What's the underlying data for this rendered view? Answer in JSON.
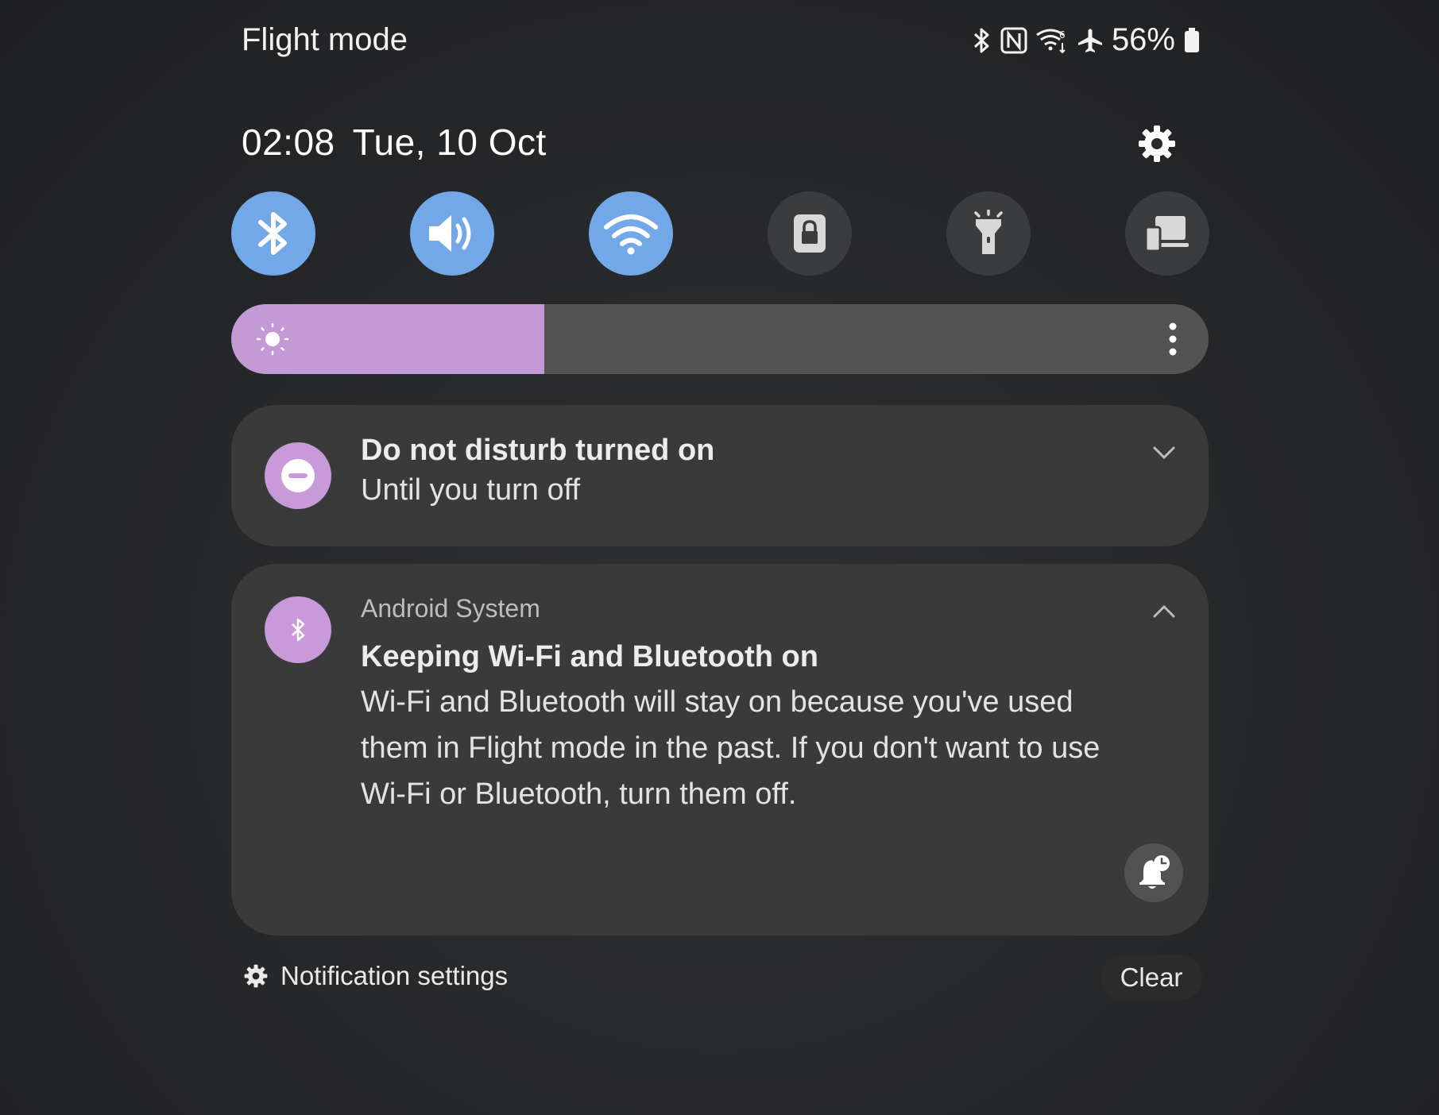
{
  "status_bar": {
    "mode_label": "Flight mode",
    "icons": [
      "bluetooth-icon",
      "nfc-icon",
      "wifi-6-icon",
      "airplane-icon",
      "battery-icon"
    ],
    "battery_text": "56%"
  },
  "header": {
    "time": "02:08",
    "date": "Tue, 10 Oct",
    "settings_icon": "gear-icon"
  },
  "quick_tiles": [
    {
      "name": "bluetooth",
      "icon": "bluetooth-icon",
      "active": true
    },
    {
      "name": "sound",
      "icon": "volume-icon",
      "active": true
    },
    {
      "name": "wifi",
      "icon": "wifi-icon",
      "active": true
    },
    {
      "name": "secure-folder",
      "icon": "lock-icon",
      "active": false
    },
    {
      "name": "torch",
      "icon": "flashlight-icon",
      "active": false
    },
    {
      "name": "device-control",
      "icon": "devices-icon",
      "active": false
    }
  ],
  "brightness": {
    "level": 0.32,
    "icon": "sun-icon",
    "more_icon": "more-vertical-icon",
    "fill_color": "#c39ad6"
  },
  "notifications": [
    {
      "icon": "dnd-icon",
      "title": "Do not disturb turned on",
      "text": "Until you turn off",
      "expanded": false
    },
    {
      "icon": "bluetooth-icon",
      "app": "Android System",
      "title": "Keeping Wi-Fi and Bluetooth on",
      "text_lines": [
        "Wi-Fi and Bluetooth will stay on because you've used",
        "them in Flight mode in the past. If you don't want to use",
        "Wi-Fi or Bluetooth, turn them off."
      ],
      "expanded": true,
      "action_icon": "snooze-bell-icon"
    }
  ],
  "footer": {
    "settings_label": "Notification settings",
    "clear_label": "Clear"
  },
  "colors": {
    "tile_active": "#72a7e8",
    "tile_inactive": "#3b3c3e",
    "accent_purple": "#c89ad9"
  }
}
